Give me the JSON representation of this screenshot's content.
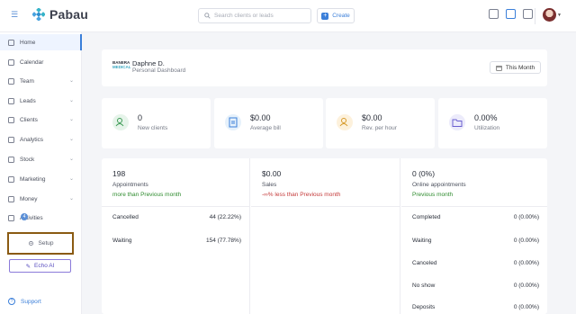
{
  "topbar": {
    "app_name": "Pabau",
    "search_placeholder": "Search clients or leads",
    "create_label": "Create"
  },
  "sidebar": {
    "items": [
      {
        "label": "Home",
        "icon": "home-icon"
      },
      {
        "label": "Calendar",
        "icon": "calendar-icon"
      },
      {
        "label": "Team",
        "icon": "team-icon"
      },
      {
        "label": "Leads",
        "icon": "leads-icon"
      },
      {
        "label": "Clients",
        "icon": "clients-icon"
      },
      {
        "label": "Analytics",
        "icon": "analytics-icon"
      },
      {
        "label": "Stock",
        "icon": "stock-icon"
      },
      {
        "label": "Marketing",
        "icon": "marketing-icon"
      },
      {
        "label": "Money",
        "icon": "money-icon"
      },
      {
        "label": "Activities",
        "icon": "activities-icon"
      }
    ],
    "activities_badge": "4",
    "setup_label": "Setup",
    "echo_label": "Echo AI",
    "support_label": "Support"
  },
  "dashboard": {
    "user_name": "Daphne D.",
    "subtitle": "Personal Dashboard",
    "logo_line1": "BANERA",
    "logo_line2": "MEDICAL",
    "period": "This Month"
  },
  "stats": [
    {
      "value": "0",
      "label": "New clients",
      "icon": "new-clients-icon",
      "color": "#e6f4ea"
    },
    {
      "value": "$0.00",
      "label": "Average bill",
      "icon": "bill-icon",
      "color": "#e6f1fb"
    },
    {
      "value": "$0.00",
      "label": "Rev. per hour",
      "icon": "revenue-icon",
      "color": "#fdf1dc"
    },
    {
      "value": "0.00%",
      "label": "Utilization",
      "icon": "folder-icon",
      "color": "#ecebfb"
    }
  ],
  "appointments": {
    "value": "198",
    "label": "Appointments",
    "note": "more than Previous month",
    "rows": [
      {
        "label": "Cancelled",
        "value": "44 (22.22%)"
      },
      {
        "label": "Waiting",
        "value": "154 (77.78%)"
      }
    ]
  },
  "sales": {
    "value": "$0.00",
    "label": "Sales",
    "note": "-∞% less than Previous month"
  },
  "online": {
    "value": "0 (0%)",
    "label": "Online appointments",
    "note": "Previous month",
    "rows": [
      {
        "label": "Completed",
        "value": "0 (0.00%)"
      },
      {
        "label": "Waiting",
        "value": "0 (0.00%)"
      },
      {
        "label": "Canceled",
        "value": "0 (0.00%)"
      },
      {
        "label": "No show",
        "value": "0 (0.00%)"
      },
      {
        "label": "Deposits",
        "value": "0 (0.00%)"
      }
    ]
  }
}
